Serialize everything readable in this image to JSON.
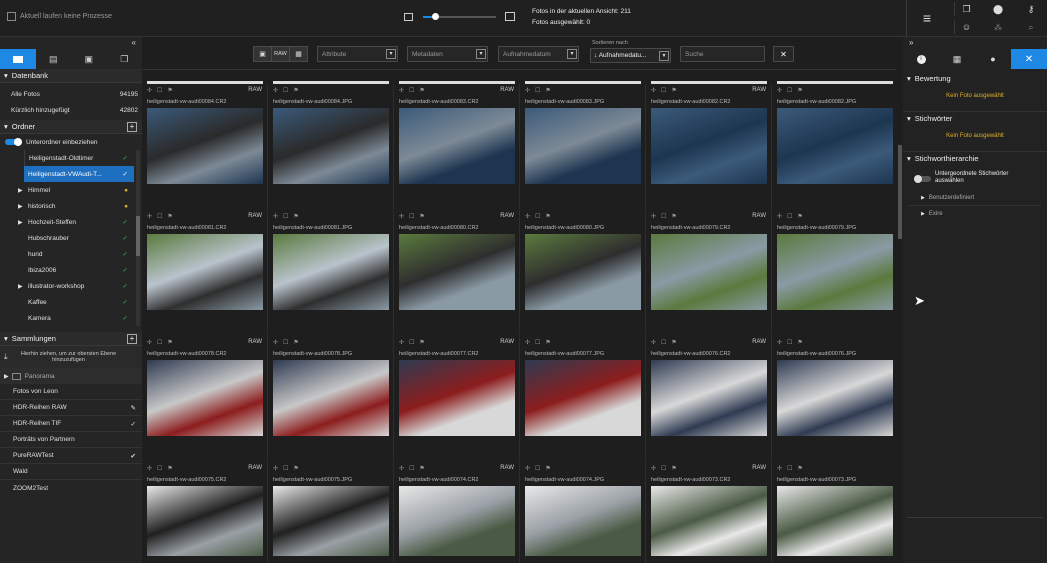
{
  "topbar": {
    "process_text": "Aktuell laufen keine Prozesse",
    "count_label": "Fotos in der aktuellen Ansicht: 211",
    "selected_label": "Fotos ausgewählt: 0"
  },
  "toolbar": {
    "filter_attribute": "Attribute",
    "filter_meta": "Metadaten",
    "filter_date": "Aufnahmedatum",
    "sort_caption": "Sortieren nach",
    "sort_value": "↓ Aufnahmedatu...",
    "search_placeholder": "Suche",
    "raw_label": "RAW",
    "close": "✕"
  },
  "left": {
    "db_title": "Datenbank",
    "all_photos": "Alle Fotos",
    "all_count": "94195",
    "recent": "Kürzlich hinzugefügt",
    "recent_count": "42802",
    "folders_title": "Ordner",
    "subfolders": "Unterordner einbeziehen",
    "folders": [
      "Heiligenstadt-Oldtimer",
      "Heiligenstadt-VWAudi-T...",
      "Himmel",
      "historisch",
      "Hochzeit-Steffen",
      "Hubschrauber",
      "hund",
      "Ibiza2006",
      "illustrator-workshop",
      "Kaffee",
      "Kamera"
    ],
    "collections_title": "Sammlungen",
    "drag_hint": "Hierhin ziehen, um zur obersten Ebene hinzuzufügen",
    "collections": [
      "Panorama",
      "Fotos von Leon",
      "HDR-Reihen RAW",
      "HDR-Reihen TIF",
      "Porträts von Partnern",
      "PureRAWTest",
      "Wald",
      "ZOOM2Test"
    ]
  },
  "grid": {
    "raw": "RAW",
    "files": [
      [
        "heiligenstadt-vw-audi00084.CR2",
        "heiligenstadt-vw-audi00084.JPG",
        "heiligenstadt-vw-audi00083.CR2",
        "heiligenstadt-vw-audi00083.JPG",
        "heiligenstadt-vw-audi00082.CR2",
        "heiligenstadt-vw-audi00082.JPG"
      ],
      [
        "heiligenstadt-vw-audi00081.CR2",
        "heiligenstadt-vw-audi00081.JPG",
        "heiligenstadt-vw-audi00080.CR2",
        "heiligenstadt-vw-audi00080.JPG",
        "heiligenstadt-vw-audi00079.CR2",
        "heiligenstadt-vw-audi00079.JPG"
      ],
      [
        "heiligenstadt-vw-audi00078.CR2",
        "heiligenstadt-vw-audi00078.JPG",
        "heiligenstadt-vw-audi00077.CR2",
        "heiligenstadt-vw-audi00077.JPG",
        "heiligenstadt-vw-audi00076.CR2",
        "heiligenstadt-vw-audi00076.JPG"
      ],
      [
        "heiligenstadt-vw-audi00075.CR2",
        "heiligenstadt-vw-audi00075.JPG",
        "heiligenstadt-vw-audi00074.CR2",
        "heiligenstadt-vw-audi00074.JPG",
        "heiligenstadt-vw-audi00073.CR2",
        "heiligenstadt-vw-audi00073.JPG"
      ]
    ]
  },
  "right": {
    "rating_title": "Bewertung",
    "no_photo": "Kein Foto ausgewählt",
    "keywords_title": "Stichwörter",
    "hierarchy_title": "Stichworthierarchie",
    "sub_keywords": "Untergeordnete Stichwörter auswählen",
    "user_defined": "Benutzerdefiniert",
    "exire": "Exire"
  },
  "colors": {
    "accent": "#1e88e5",
    "bg": "#1e1e1e",
    "warn": "#e0b020",
    "ok": "#4caf50"
  }
}
